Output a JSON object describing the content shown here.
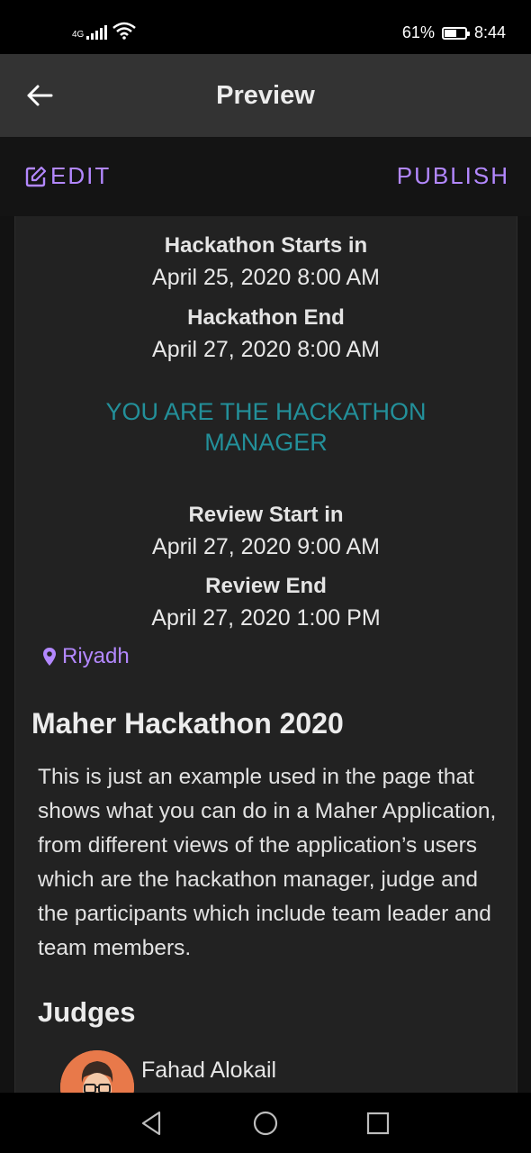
{
  "status_bar": {
    "network": "4G",
    "battery_percent": "61%",
    "battery_level": 0.61,
    "time": "8:44"
  },
  "app_bar": {
    "title": "Preview",
    "back_icon": "arrow-left-icon"
  },
  "actions": {
    "edit_label": "EDIT",
    "edit_icon": "edit-square-icon",
    "publish_label": "PUBLISH",
    "accent_color": "#b388ff"
  },
  "schedule": {
    "hackathon_start_label": "Hackathon Starts in",
    "hackathon_start_date": "April 25, 2020 8:00 AM",
    "hackathon_end_label": "Hackathon End",
    "hackathon_end_date": "April 27, 2020 8:00 AM",
    "review_start_label": "Review Start in",
    "review_start_date": "April 27, 2020 9:00 AM",
    "review_end_label": "Review End",
    "review_end_date": "April 27, 2020 1:00 PM"
  },
  "manager_note": {
    "text": "YOU ARE THE HACKATHON MANAGER",
    "color": "#23909a"
  },
  "location": {
    "icon": "map-pin-icon",
    "text": "Riyadh"
  },
  "event": {
    "title": "Maher Hackathon 2020",
    "description": "This is just an example used in the page that shows what you can do in a Maher Application, from different views of the application’s users which are the hackathon manager, judge and the participants which include team leader and team members."
  },
  "judges": {
    "heading": "Judges",
    "items": [
      {
        "name": "Fahad Alokail",
        "avatar_color": "#e8794a"
      }
    ]
  },
  "nav_bar": {
    "back_icon": "triangle-back-icon",
    "home_icon": "circle-home-icon",
    "recents_icon": "square-recents-icon"
  }
}
